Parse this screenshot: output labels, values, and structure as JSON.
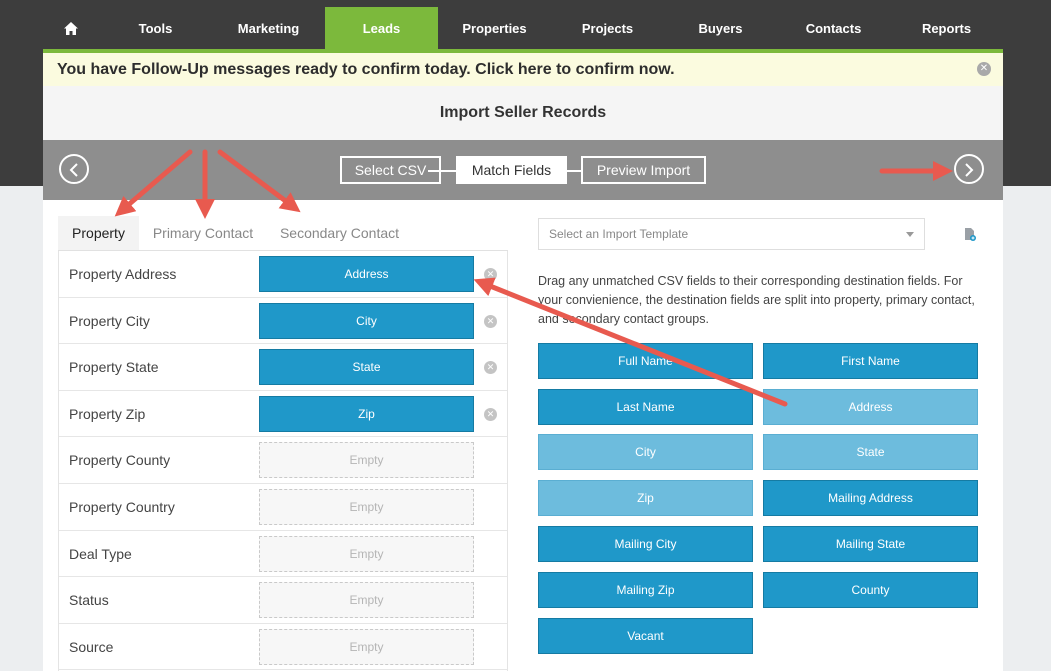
{
  "nav": {
    "items": [
      {
        "name": "nav-home",
        "label": "",
        "icon": "home-icon"
      },
      {
        "name": "nav-tools",
        "label": "Tools"
      },
      {
        "name": "nav-marketing",
        "label": "Marketing"
      },
      {
        "name": "nav-leads",
        "label": "Leads",
        "active": true
      },
      {
        "name": "nav-properties",
        "label": "Properties"
      },
      {
        "name": "nav-projects",
        "label": "Projects"
      },
      {
        "name": "nav-buyers",
        "label": "Buyers"
      },
      {
        "name": "nav-contacts",
        "label": "Contacts"
      },
      {
        "name": "nav-reports",
        "label": "Reports"
      }
    ]
  },
  "alert": {
    "text": "You have Follow-Up messages ready to confirm today. Click here to confirm now."
  },
  "page": {
    "title": "Import Seller Records"
  },
  "wizard": {
    "steps": [
      {
        "label": "Select CSV"
      },
      {
        "label": "Match Fields",
        "active": true
      },
      {
        "label": "Preview Import"
      }
    ]
  },
  "tabs": [
    {
      "label": "Property",
      "active": true
    },
    {
      "label": "Primary Contact"
    },
    {
      "label": "Secondary Contact"
    }
  ],
  "destination_fields": [
    {
      "label": "Property Address",
      "value": "Address",
      "filled": true
    },
    {
      "label": "Property City",
      "value": "City",
      "filled": true
    },
    {
      "label": "Property State",
      "value": "State",
      "filled": true
    },
    {
      "label": "Property Zip",
      "value": "Zip",
      "filled": true
    },
    {
      "label": "Property County",
      "value": "Empty",
      "filled": false
    },
    {
      "label": "Property Country",
      "value": "Empty",
      "filled": false
    },
    {
      "label": "Deal Type",
      "value": "Empty",
      "filled": false
    },
    {
      "label": "Status",
      "value": "Empty",
      "filled": false
    },
    {
      "label": "Source",
      "value": "Empty",
      "filled": false
    }
  ],
  "template": {
    "placeholder": "Select an Import Template"
  },
  "instructions": "Drag any unmatched CSV fields to their corresponding destination fields. For your convienience, the destination fields are split into property, primary contact, and secondary contact groups.",
  "csv_fields": [
    {
      "label": "Full Name",
      "matched": false
    },
    {
      "label": "First Name",
      "matched": false
    },
    {
      "label": "Last Name",
      "matched": false
    },
    {
      "label": "Address",
      "matched": true
    },
    {
      "label": "City",
      "matched": true
    },
    {
      "label": "State",
      "matched": true
    },
    {
      "label": "Zip",
      "matched": true
    },
    {
      "label": "Mailing Address",
      "matched": false
    },
    {
      "label": "Mailing City",
      "matched": false
    },
    {
      "label": "Mailing State",
      "matched": false
    },
    {
      "label": "Mailing Zip",
      "matched": false
    },
    {
      "label": "County",
      "matched": false
    },
    {
      "label": "Vacant",
      "matched": false
    }
  ],
  "colors": {
    "accent_green": "#7cb93c",
    "field_blue": "#1f98c9",
    "matched_blue": "#6dbcdd",
    "annotation_red": "#e85a4f"
  }
}
